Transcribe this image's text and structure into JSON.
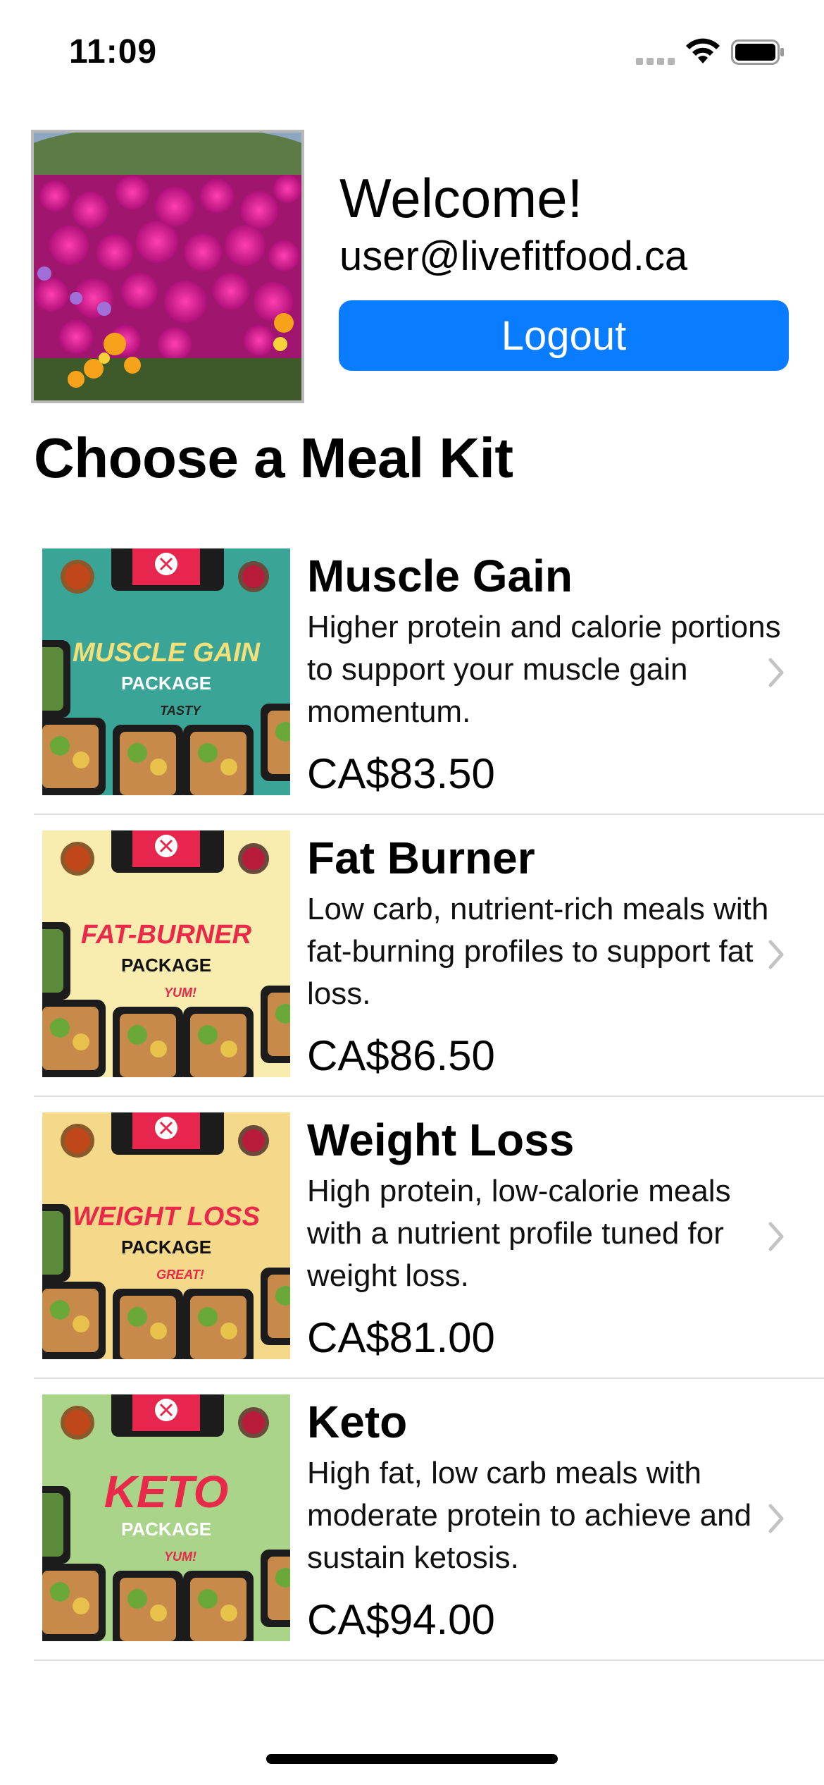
{
  "status_bar": {
    "time": "11:09",
    "icons": [
      "signal-icon",
      "wifi-icon",
      "battery-icon"
    ]
  },
  "profile": {
    "photo_icon": "flowers-photo",
    "welcome": "Welcome!",
    "email": "user@livefitfood.ca",
    "logout_label": "Logout",
    "accent": "#0a7cff"
  },
  "section_title": "Choose a Meal Kit",
  "meals": [
    {
      "name": "Muscle Gain",
      "description": "Higher protein and calorie portions to support your muscle gain momentum.",
      "price": "CA$83.50",
      "image_title": "MUSCLE GAIN",
      "image_sub": "PACKAGE",
      "image_tag": "TASTY",
      "image_bg": "#3aa596",
      "title_color": "#f3e07a",
      "sub_color": "#ffffff"
    },
    {
      "name": "Fat Burner",
      "description": "Low carb, nutrient-rich meals with fat-burning profiles to support fat loss.",
      "price": "CA$86.50",
      "image_title": "FAT-BURNER",
      "image_sub": "PACKAGE",
      "image_tag": "YUM!",
      "image_bg": "#f8ecae",
      "title_color": "#e8294a",
      "sub_color": "#111111"
    },
    {
      "name": "Weight Loss",
      "description": "High protein, low-calorie meals with a nutrient profile tuned for weight loss.",
      "price": "CA$81.00",
      "image_title": "WEIGHT LOSS",
      "image_sub": "PACKAGE",
      "image_tag": "GREAT!",
      "image_bg": "#f5d98a",
      "title_color": "#e8294a",
      "sub_color": "#111111"
    },
    {
      "name": "Keto",
      "description": "High fat, low carb meals with moderate protein to achieve and sustain ketosis.",
      "price": "CA$94.00",
      "image_title": "KETO",
      "image_sub": "PACKAGE",
      "image_tag": "YUM!",
      "image_bg": "#a9d48a",
      "title_color": "#e8294a",
      "sub_color": "#ffffff"
    }
  ]
}
